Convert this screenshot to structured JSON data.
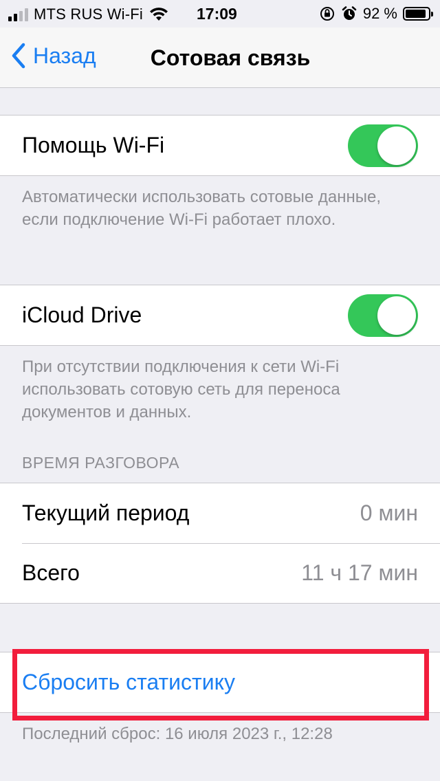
{
  "status_bar": {
    "carrier": "MTS RUS Wi-Fi",
    "time": "17:09",
    "battery_percent": "92 %",
    "battery_level": 0.92,
    "icons": [
      "signal-icon",
      "wifi-icon",
      "orientation-lock-icon",
      "alarm-icon",
      "battery-icon"
    ]
  },
  "nav": {
    "back_label": "Назад",
    "title": "Сотовая связь"
  },
  "wifi_assist": {
    "label": "Помощь Wi-Fi",
    "enabled": true,
    "footer": "Автоматически использовать сотовые данные, если подключение Wi-Fi работает плохо."
  },
  "icloud_drive": {
    "label": "iCloud Drive",
    "enabled": true,
    "footer": "При отсутствии подключения к сети Wi-Fi использовать сотовую сеть для переноса документов и данных."
  },
  "call_time": {
    "header": "ВРЕМЯ РАЗГОВОРА",
    "rows": [
      {
        "label": "Текущий период",
        "value": "0 мин"
      },
      {
        "label": "Всего",
        "value": "11 ч 17 мин"
      }
    ]
  },
  "reset": {
    "label": "Сбросить статистику",
    "last_reset": "Последний сброс: 16 июля 2023 г., 12:28"
  },
  "colors": {
    "accent": "#1a7ef2",
    "toggle_on": "#34c759",
    "highlight": "#f21d3c",
    "background": "#efeff4"
  }
}
